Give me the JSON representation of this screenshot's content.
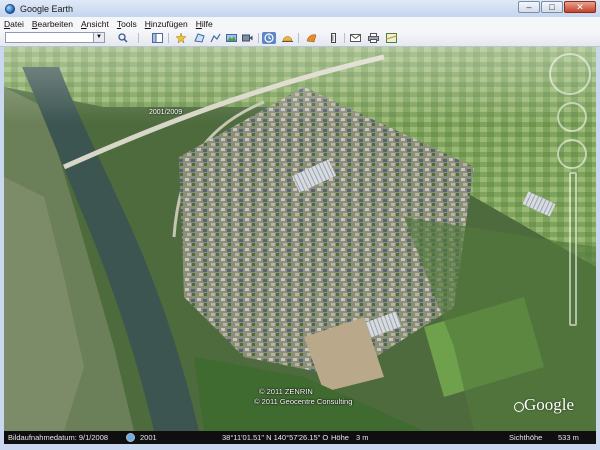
{
  "window": {
    "title": "Google Earth",
    "controls": {
      "minimize": "–",
      "maximize": "□",
      "close": "✕"
    }
  },
  "menubar": {
    "items": [
      {
        "accel": "D",
        "rest": "atei"
      },
      {
        "accel": "B",
        "rest": "earbeiten"
      },
      {
        "accel": "A",
        "rest": "nsicht"
      },
      {
        "accel": "T",
        "rest": "ools"
      },
      {
        "accel": "H",
        "rest": "inzufügen"
      },
      {
        "accel": "H",
        "rest": "ilfe"
      }
    ]
  },
  "toolbar": {
    "search_value": "",
    "icons": [
      "search-icon",
      "sidebar-toggle-icon",
      "placemark-icon",
      "polygon-icon",
      "path-icon",
      "image-overlay-icon",
      "record-tour-icon",
      "historical-imagery-icon",
      "sunlight-icon",
      "switch-to-sky-icon",
      "ruler-icon",
      "email-icon",
      "print-icon",
      "view-in-maps-icon"
    ]
  },
  "map": {
    "timeline_year": "2001/2009",
    "copyright_lines": [
      "© 2011 ZENRIN",
      "© 2011 Geocentre Consulting"
    ],
    "logo": "Google"
  },
  "statusbar": {
    "imagery_date_label": "Bildaufnahmedatum: 9/1/2008",
    "year": "2001",
    "coordinates": "38°11'01.51\" N  140°57'26.15\" O",
    "elevation_label": "Höhe",
    "elevation_value": "3 m",
    "eye_alt_label": "Sichthöhe",
    "eye_alt_value": "533 m"
  },
  "colors": {
    "titlebar": "#c5d5ee",
    "statusbar": "#0f0f0f",
    "river": "#3c5550",
    "fields": "#7fa45a",
    "active_tool": "#5d86c6"
  }
}
